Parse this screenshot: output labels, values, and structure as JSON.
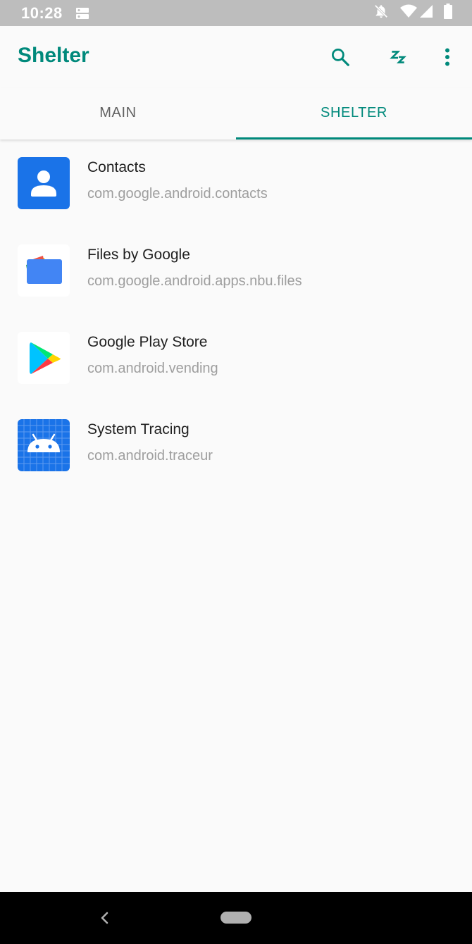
{
  "status_bar": {
    "time": "10:28",
    "icons": [
      "notification-icon",
      "do-not-disturb-icon",
      "wifi-icon",
      "signal-icon",
      "battery-icon"
    ]
  },
  "app_bar": {
    "title": "Shelter",
    "actions": [
      "search-icon",
      "freeze-icon",
      "more-vert-icon"
    ]
  },
  "tabs": [
    {
      "label": "MAIN",
      "selected": false
    },
    {
      "label": "SHELTER",
      "selected": true
    }
  ],
  "apps": [
    {
      "name": "Contacts",
      "package": "com.google.android.contacts",
      "icon": "contacts-app-icon"
    },
    {
      "name": "Files by Google",
      "package": "com.google.android.apps.nbu.files",
      "icon": "files-app-icon"
    },
    {
      "name": "Google Play Store",
      "package": "com.android.vending",
      "icon": "play-store-app-icon"
    },
    {
      "name": "System Tracing",
      "package": "com.android.traceur",
      "icon": "system-tracing-app-icon"
    }
  ],
  "colors": {
    "accent": "#00897b",
    "status_bar": "#bdbdbd",
    "background": "#fafafa",
    "nav_bar": "#000000"
  }
}
